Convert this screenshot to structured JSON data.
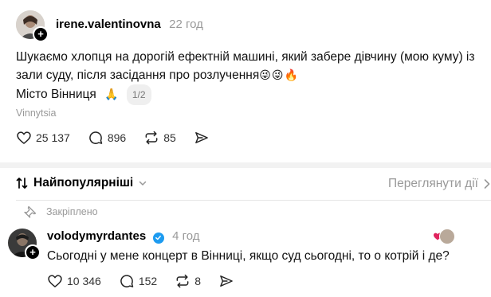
{
  "post": {
    "username": "irene.valentinovna",
    "time": "22 год",
    "text_line1": "Шукаємо хлопця на дорогій ефектній машині, який забере дівчину (мою куму) із",
    "text_line2": "зали суду, після засідання про розлучення",
    "emojis_line2": "😜😜🔥",
    "text_line3": "Місто Вінниця",
    "emoji_line3": "🙏",
    "page_indicator": "1/2",
    "location": "Vinnytsia",
    "likes": "25 137",
    "comments": "896",
    "reposts": "85"
  },
  "sort": {
    "label": "Найпопулярніші",
    "view_activity": "Переглянути дії"
  },
  "reply": {
    "pinned_label": "Закріплено",
    "username": "volodymyrdantes",
    "time": "4 год",
    "text": "Сьогодні у мене концерт в Вінниці, якщо суд сьогодні, то о котрій і де?",
    "likes": "10 346",
    "comments": "152",
    "reposts": "8"
  },
  "colors": {
    "verified": "#1d9bf0",
    "liked_heart": "#e0245e",
    "muted_text": "#999999"
  }
}
